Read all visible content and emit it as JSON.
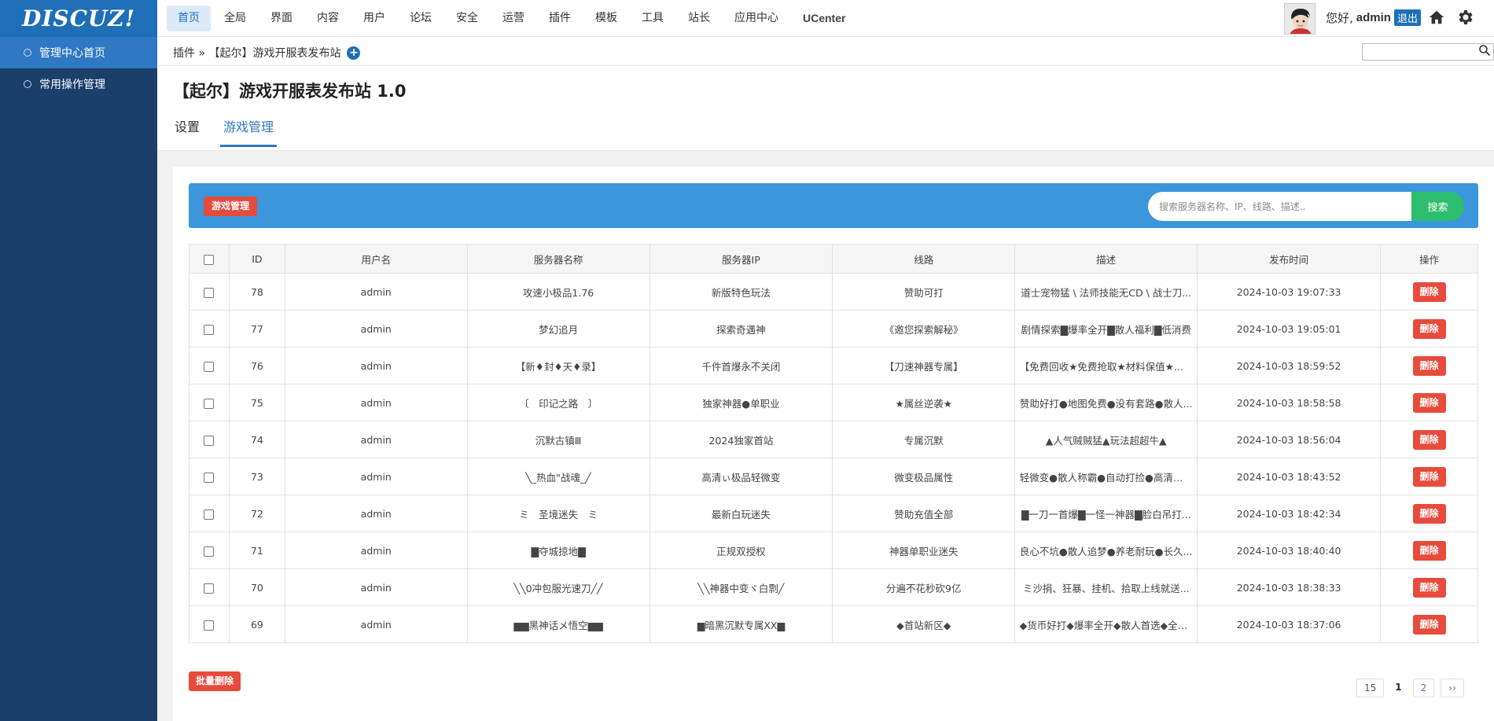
{
  "header": {
    "logo": "DISCUZ!",
    "nav": [
      "首页",
      "全局",
      "界面",
      "内容",
      "用户",
      "论坛",
      "安全",
      "运营",
      "插件",
      "模板",
      "工具",
      "站长",
      "应用中心",
      "UCenter"
    ],
    "greeting": "您好,",
    "username": "admin",
    "logout": "退出"
  },
  "sidebar": {
    "items": [
      {
        "label": "管理中心首页"
      },
      {
        "label": "常用操作管理"
      }
    ]
  },
  "breadcrumb": {
    "text": "插件 » 【起尔】游戏开服表发布站"
  },
  "page": {
    "title": "【起尔】游戏开服表发布站 1.0",
    "tabs": [
      "设置",
      "游戏管理"
    ]
  },
  "toolbar": {
    "label": "游戏管理",
    "search_placeholder": "搜索服务器名称、IP、线路、描述..",
    "search_button": "搜索"
  },
  "table": {
    "headers": [
      "ID",
      "用户名",
      "服务器名称",
      "服务器IP",
      "线路",
      "描述",
      "发布时间",
      "操作"
    ],
    "rows": [
      {
        "id": "78",
        "user": "admin",
        "name": "攻速小极品1.76",
        "ip": "新版特色玩法",
        "line": "赞助可打",
        "desc": "道士宠物猛 \\ 法师技能无CD \\ 战士刀...",
        "time": "2024-10-03 19:07:33",
        "action": "删除"
      },
      {
        "id": "77",
        "user": "admin",
        "name": "梦幻追月",
        "ip": "探索奇遇神",
        "line": "《邀您探索解秘》",
        "desc": "剧情探索▇爆率全开▇散人福利▇低消费",
        "time": "2024-10-03 19:05:01",
        "action": "删除"
      },
      {
        "id": "76",
        "user": "admin",
        "name": "【新♦封♦天♦录】",
        "ip": "千件首爆永不关闭",
        "line": "【刀速神器专属】",
        "desc": "【免费回收★免费抢取★材料保值★装...",
        "time": "2024-10-03 18:59:52",
        "action": "删除"
      },
      {
        "id": "75",
        "user": "admin",
        "name": "〔　印记之路　〕",
        "ip": "独家神器●单职业",
        "line": "★属丝逆袭★",
        "desc": "赞助好打●地图免费●没有套路●散人...",
        "time": "2024-10-03 18:58:58",
        "action": "删除"
      },
      {
        "id": "74",
        "user": "admin",
        "name": "沉默古镇Ⅲ",
        "ip": "2024独家首站",
        "line": "专属沉默",
        "desc": "▲人气贼贼猛▲玩法超超牛▲",
        "time": "2024-10-03 18:56:04",
        "action": "删除"
      },
      {
        "id": "73",
        "user": "admin",
        "name": "╲_热血\"战魂_╱",
        "ip": "高清ぃ极品轻微变",
        "line": "微变极品属性",
        "desc": "轻微变●散人称霸●自动打捡●高清画质",
        "time": "2024-10-03 18:43:52",
        "action": "删除"
      },
      {
        "id": "72",
        "user": "admin",
        "name": "ミ　圣境迷失　ミ",
        "ip": "最新白玩迷失",
        "line": "赞助充值全部",
        "desc": "▇一刀一首爆▇一怪一神器▇脸白吊打...",
        "time": "2024-10-03 18:42:34",
        "action": "删除"
      },
      {
        "id": "71",
        "user": "admin",
        "name": "▇夺城掠地▇",
        "ip": "正规双授权",
        "line": "神器单职业迷失",
        "desc": "良心不坑●散人追梦●养老耐玩●长久...",
        "time": "2024-10-03 18:40:40",
        "action": "删除"
      },
      {
        "id": "70",
        "user": "admin",
        "name": "╲╲0冲包服光速刀╱╱",
        "ip": "╲╲神器中变ヾ白剽╱",
        "line": "分遍不花秒砍9亿",
        "desc": "ミ沙捐、狂暴、挂机、拾取上线就送...",
        "time": "2024-10-03 18:38:33",
        "action": "删除"
      },
      {
        "id": "69",
        "user": "admin",
        "name": "▆▆黑神话メ悟空▆▆",
        "ip": "▆暗黑沉默专属XX▆",
        "line": "◆首站新区◆",
        "desc": "◆货币好打◆爆率全开◆散人首选◆全程...",
        "time": "2024-10-03 18:37:06",
        "action": "删除"
      }
    ]
  },
  "footer": {
    "batch_delete": "批量删除",
    "pager": {
      "total": "15",
      "current": "1",
      "next_page": "2",
      "next": "››"
    }
  },
  "colors": {
    "brand": "#1e6fb8",
    "sidebar": "#1a3f6a",
    "danger": "#e64b3c",
    "success": "#2dbd6e",
    "toolbar": "#3b96db"
  }
}
